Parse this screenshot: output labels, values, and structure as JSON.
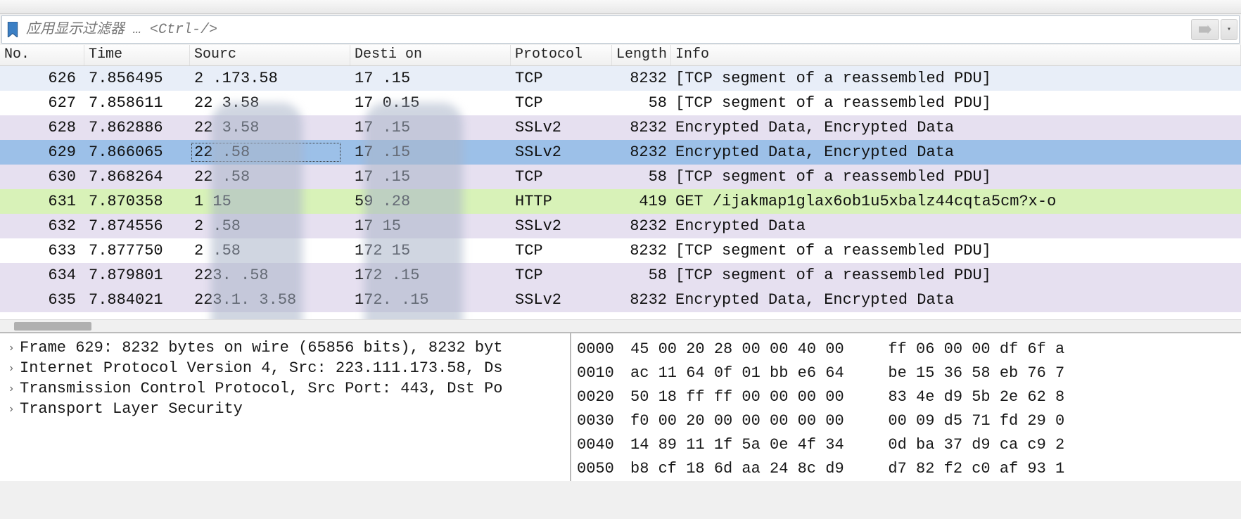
{
  "filter": {
    "placeholder": "应用显示过滤器 … <Ctrl-/>"
  },
  "columns": {
    "no": "No.",
    "time": "Time",
    "source": "Sourc",
    "destination": "Desti    on",
    "protocol": "Protocol",
    "length": "Length",
    "info": "Info"
  },
  "packets": [
    {
      "no": "626",
      "time": "7.856495",
      "source": "2        .173.58",
      "destination": "17          .15",
      "protocol": "TCP",
      "length": "8232",
      "info": "[TCP segment of a reassembled PDU]",
      "style": "row-tcp-light"
    },
    {
      "no": "627",
      "time": "7.858611",
      "source": "22        3.58",
      "destination": "17         0.15",
      "protocol": "TCP",
      "length": "58",
      "info": "[TCP segment of a reassembled PDU]",
      "style": "row-tcp-white"
    },
    {
      "no": "628",
      "time": "7.862886",
      "source": "22        3.58",
      "destination": "17          .15",
      "protocol": "SSLv2",
      "length": "8232",
      "info": "Encrypted Data, Encrypted Data",
      "style": "row-ssl"
    },
    {
      "no": "629",
      "time": "7.866065",
      "source": "22         .58",
      "destination": "17          .15",
      "protocol": "SSLv2",
      "length": "8232",
      "info": "Encrypted Data, Encrypted Data",
      "style": "row-ssl-selected"
    },
    {
      "no": "630",
      "time": "7.868264",
      "source": "22         .58",
      "destination": "17          .15",
      "protocol": "TCP",
      "length": "58",
      "info": "[TCP segment of a reassembled PDU]",
      "style": "row-ssl"
    },
    {
      "no": "631",
      "time": "7.870358",
      "source": "1          15",
      "destination": "59          .28",
      "protocol": "HTTP",
      "length": "419",
      "info": "GET /ijakmap1glax6ob1u5xbalz44cqta5cm?x-o",
      "style": "row-http"
    },
    {
      "no": "632",
      "time": "7.874556",
      "source": "2          .58",
      "destination": "17          15",
      "protocol": "SSLv2",
      "length": "8232",
      "info": "Encrypted Data",
      "style": "row-ssl"
    },
    {
      "no": "633",
      "time": "7.877750",
      "source": "2          .58",
      "destination": "172         15",
      "protocol": "TCP",
      "length": "8232",
      "info": "[TCP segment of a reassembled PDU]",
      "style": "row-tcp-white"
    },
    {
      "no": "634",
      "time": "7.879801",
      "source": "223.        .58",
      "destination": "172        .15",
      "protocol": "TCP",
      "length": "58",
      "info": "[TCP segment of a reassembled PDU]",
      "style": "row-ssl"
    },
    {
      "no": "635",
      "time": "7.884021",
      "source": "223.1.     3.58",
      "destination": "172.       .15",
      "protocol": "SSLv2",
      "length": "8232",
      "info": "Encrypted Data, Encrypted Data",
      "style": "row-ssl"
    }
  ],
  "details": [
    "Frame 629: 8232 bytes on wire (65856 bits), 8232 byt",
    "Internet Protocol Version 4, Src: 223.111.173.58, Ds",
    "Transmission Control Protocol, Src Port: 443, Dst Po",
    "Transport Layer Security"
  ],
  "bytes": [
    {
      "off": "0000",
      "h1": "45 00 20 28 00 00 40 00",
      "h2": "ff 06 00 00 df 6f a"
    },
    {
      "off": "0010",
      "h1": "ac 11 64 0f 01 bb e6 64",
      "h2": "be 15 36 58 eb 76 7"
    },
    {
      "off": "0020",
      "h1": "50 18 ff ff 00 00 00 00",
      "h2": "83 4e d9 5b 2e 62 8"
    },
    {
      "off": "0030",
      "h1": "f0 00 20 00 00 00 00 00",
      "h2": "00 09 d5 71 fd 29 0"
    },
    {
      "off": "0040",
      "h1": "14 89 11 1f 5a 0e 4f 34",
      "h2": "0d ba 37 d9 ca c9 2"
    },
    {
      "off": "0050",
      "h1": "b8 cf 18 6d aa 24 8c d9",
      "h2": "d7 82 f2 c0 af 93 1"
    }
  ]
}
